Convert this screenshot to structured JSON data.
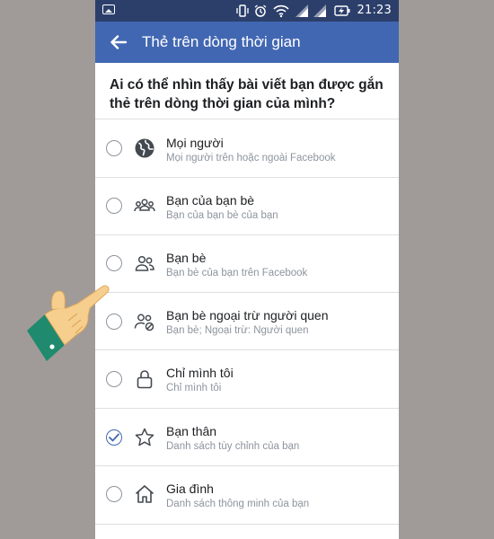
{
  "status_bar": {
    "time": "21:23",
    "icons": [
      "gallery-icon",
      "vibrate-icon",
      "alarm-icon",
      "wifi-icon",
      "signal-icon",
      "signal-icon",
      "battery-charging-icon"
    ]
  },
  "app_bar": {
    "title": "Thẻ trên dòng thời gian",
    "back_icon": "back-arrow-icon",
    "background": "#4267b2"
  },
  "question": "Ai có thể nhìn thấy bài viết bạn được gắn thẻ trên dòng thời gian của mình?",
  "options": [
    {
      "title": "Mọi người",
      "subtitle": "Mọi người trên hoặc ngoài Facebook",
      "icon": "globe-icon",
      "selected": false
    },
    {
      "title": "Bạn của bạn bè",
      "subtitle": "Bạn của bạn bè của bạn",
      "icon": "friends-of-friends-icon",
      "selected": false
    },
    {
      "title": "Bạn bè",
      "subtitle": "Bạn bè của bạn trên Facebook",
      "icon": "friends-icon",
      "selected": false
    },
    {
      "title": "Bạn bè ngoại trừ người quen",
      "subtitle": "Bạn bè; Ngoại trừ: Người quen",
      "icon": "friends-except-icon",
      "selected": false
    },
    {
      "title": "Chỉ mình tôi",
      "subtitle": "Chỉ mình tôi",
      "icon": "lock-icon",
      "selected": false
    },
    {
      "title": "Bạn thân",
      "subtitle": "Danh sách tùy chỉnh của bạn",
      "icon": "star-icon",
      "selected": true
    },
    {
      "title": "Gia đình",
      "subtitle": "Danh sách thông minh của bạn",
      "icon": "home-icon",
      "selected": false
    }
  ],
  "colors": {
    "accent": "#4267b2",
    "status_bar": "#2c3f6b",
    "outer_background": "#a09b98",
    "hand_skin": "#f6cf8f",
    "hand_sleeve": "#1f8a6e"
  }
}
